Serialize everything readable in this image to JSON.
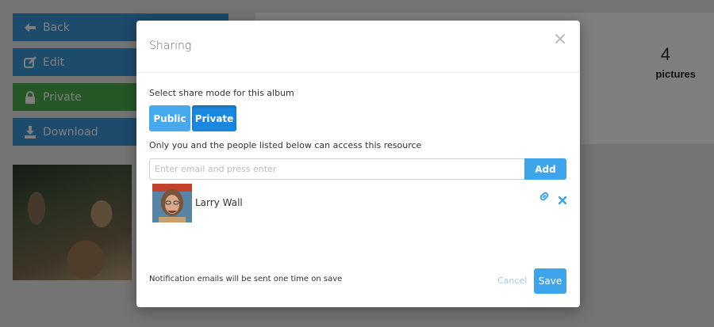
{
  "background": {
    "buttons": [
      {
        "label": "Back",
        "icon": "arrow-left-icon"
      },
      {
        "label": "Edit",
        "icon": "edit-icon"
      },
      {
        "label": "Private",
        "icon": "lock-icon"
      },
      {
        "label": "Download",
        "icon": "download-icon"
      }
    ],
    "stats": {
      "count": "4",
      "label": "pictures"
    },
    "photo_alt": "camel-photo"
  },
  "modal": {
    "title": "Sharing",
    "close_icon": "close-icon",
    "mode_label": "Select share mode for this album",
    "modes": {
      "public": "Public",
      "private": "Private",
      "selected": "Private"
    },
    "access_text": "Only you and the people listed below can access this resource",
    "email_input": {
      "placeholder": "Enter email and press enter",
      "value": ""
    },
    "add_label": "Add",
    "users": [
      {
        "name": "Larry Wall",
        "link_icon": "link-icon",
        "remove_icon": "remove-icon"
      }
    ],
    "notify_text": "Notification emails will be sent one time on save",
    "cancel_label": "Cancel",
    "save_label": "Save"
  },
  "colors": {
    "primary_blue": "#3ea4ec",
    "button_blue": "#3b97d8",
    "button_green": "#4cae4c",
    "selected_mode": "#1a88e0"
  }
}
